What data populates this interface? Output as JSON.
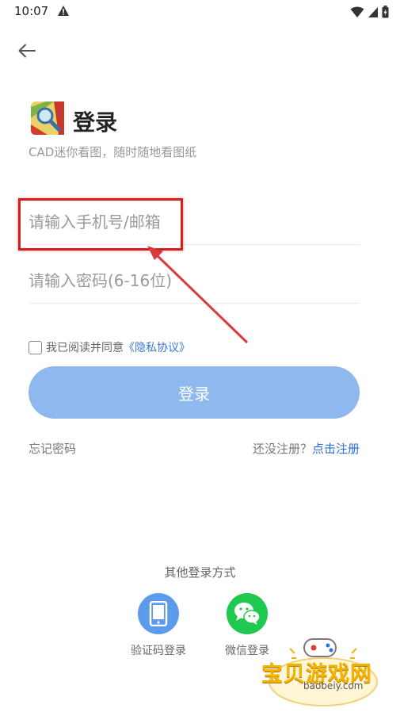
{
  "status_bar": {
    "time": "10:07"
  },
  "header": {
    "title": "登录",
    "subtitle": "CAD迷你看图，随时随地看图纸"
  },
  "form": {
    "phone_placeholder": "请输入手机号/邮箱",
    "password_placeholder": "请输入密码(6-16位)",
    "agree_text": "我已阅读并同意",
    "policy_link": "《隐私协议》",
    "login_button": "登录"
  },
  "links": {
    "forgot_password": "忘记密码",
    "no_account": "还没注册？",
    "register": "点击注册"
  },
  "other_login": {
    "title": "其他登录方式",
    "options": [
      {
        "label": "验证码登录",
        "icon": "phone-icon",
        "color": "#5b9bea"
      },
      {
        "label": "微信登录",
        "icon": "wechat-icon",
        "color": "#1fc94f"
      }
    ]
  },
  "watermark": {
    "text": "宝贝游戏网",
    "domain": "baobeiy.com"
  },
  "colors": {
    "accent": "#2b6fd6",
    "button": "#8fb8ef",
    "annotation": "#d61c1c"
  }
}
